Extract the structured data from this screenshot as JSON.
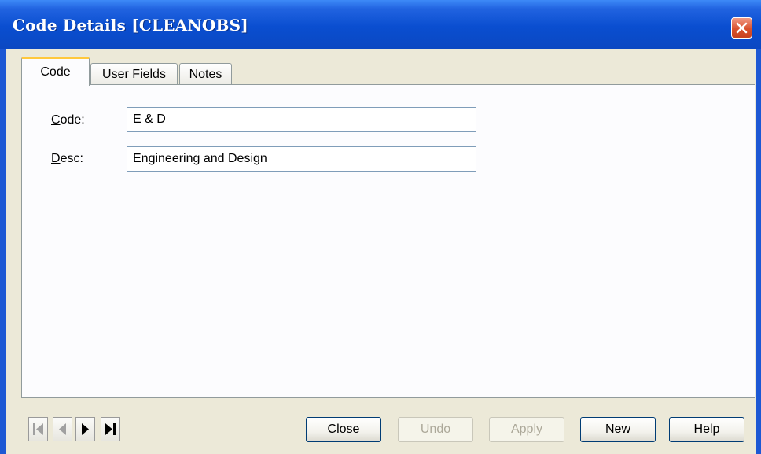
{
  "window": {
    "title": "Code Details  [CLEANOBS]"
  },
  "tabs": [
    {
      "label": "Code",
      "active": true
    },
    {
      "label": "User Fields",
      "active": false
    },
    {
      "label": "Notes",
      "active": false
    }
  ],
  "form": {
    "code_label_ul": "C",
    "code_label_rest": "ode:",
    "code_value": "E & D",
    "desc_label_ul": "D",
    "desc_label_rest": "esc:",
    "desc_value": "Engineering and Design"
  },
  "navigation": [
    {
      "icon": "first-record-icon",
      "enabled": false
    },
    {
      "icon": "previous-record-icon",
      "enabled": false
    },
    {
      "icon": "next-record-icon",
      "enabled": true
    },
    {
      "icon": "last-record-icon",
      "enabled": true
    }
  ],
  "buttons": {
    "close": {
      "label": "Close"
    },
    "undo": {
      "ul": "U",
      "rest": "ndo",
      "enabled": false
    },
    "apply": {
      "ul": "A",
      "rest": "pply",
      "enabled": false
    },
    "new": {
      "ul": "N",
      "rest": "ew",
      "enabled": true
    },
    "help": {
      "ul": "H",
      "rest": "elp",
      "enabled": true
    }
  },
  "colors": {
    "titlebar": "#0a4ed0",
    "active_tab_accent": "#ffc83c",
    "close_button": "#d9512d",
    "dialog_bg": "#ece9d8"
  }
}
